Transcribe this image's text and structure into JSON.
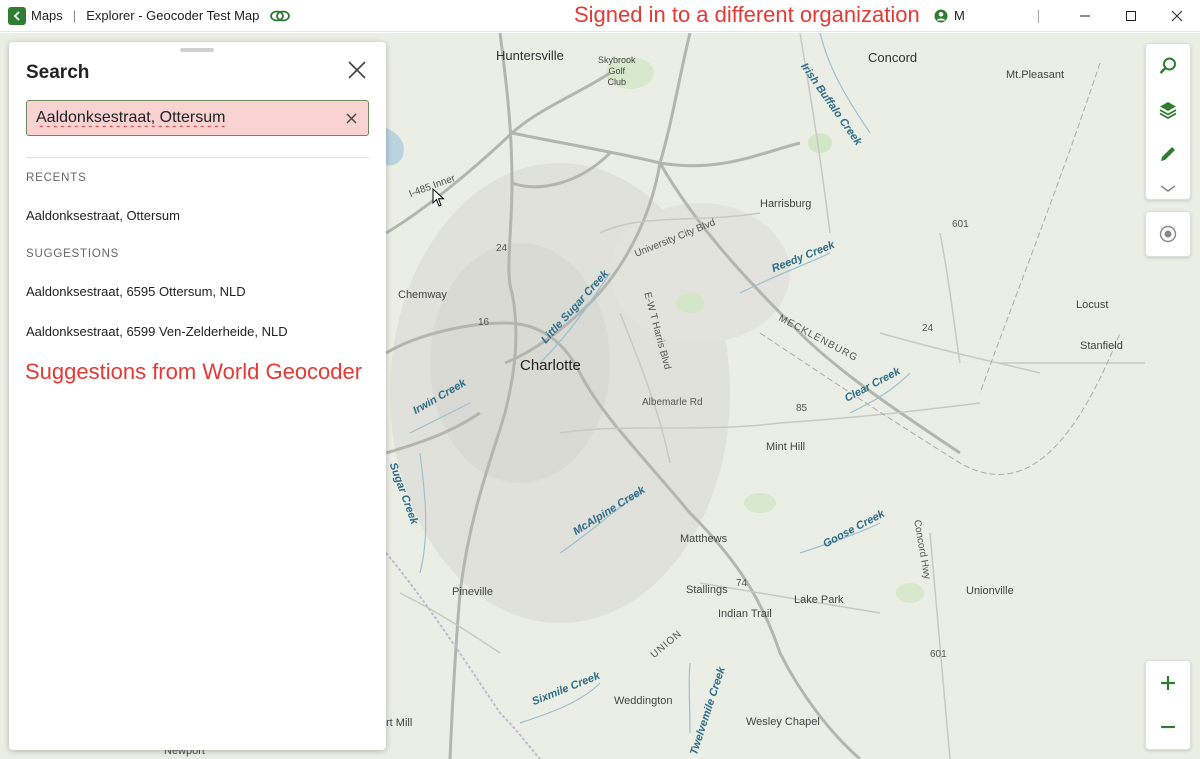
{
  "titlebar": {
    "app_name": "Maps",
    "separator": "|",
    "map_title": "Explorer - Geocoder Test Map",
    "annotation": "Signed in to a different organization",
    "user_initial": "M"
  },
  "search_panel": {
    "title": "Search",
    "query": "Aaldonksestraat, Ottersum",
    "recents_label": "RECENTS",
    "recents": [
      "Aaldonksestraat, Ottersum"
    ],
    "suggestions_label": "SUGGESTIONS",
    "suggestions": [
      "Aaldonksestraat, 6595 Ottersum, NLD",
      "Aaldonksestraat, 6599 Ven-Zelderheide, NLD"
    ],
    "annotation": "Suggestions from World Geocoder"
  },
  "map": {
    "cities": {
      "charlotte": "Charlotte",
      "huntersville": "Huntersville",
      "concord": "Concord",
      "mt_pleasant": "Mt.Pleasant",
      "harrisburg": "Harrisburg",
      "skybrook": "Skybrook\nGolf\nClub",
      "chemway": "Chemway",
      "locust": "Locust",
      "stanfield": "Stanfield",
      "mint_hill": "Mint Hill",
      "matthews": "Matthews",
      "stallings": "Stallings",
      "indian_trail": "Indian Trail",
      "lake_park": "Lake Park",
      "unionville": "Unionville",
      "pineville": "Pineville",
      "weddington": "Weddington",
      "wesley_chapel": "Wesley Chapel",
      "newport": "Newport",
      "mill": "rt Mill"
    },
    "water": {
      "irish_buffalo": "Irish Buffalo Creek",
      "reedy": "Reedy Creek",
      "little_sugar": "Little Sugar Creek",
      "irwin": "Irwin Creek",
      "sugar": "Sugar Creek",
      "mcalpine": "McAlpine Creek",
      "clear": "Clear Creek",
      "goose": "Goose Creek",
      "sixmile": "Sixmile Creek",
      "twelvemile": "Twelvemile Creek"
    },
    "roads": {
      "i485": "I-485 Inner",
      "university": "University City Blvd",
      "albemarle": "Albemarle Rd",
      "wt_harris": "E-W T Harris Blvd",
      "concord_hwy": "Concord Hwy",
      "mecklenburg": "MECKLENBURG",
      "union": "UNION",
      "r24": "24",
      "r24b": "24",
      "r16": "16",
      "r74": "74",
      "r601": "601",
      "r601b": "601",
      "r85": "85"
    }
  },
  "colors": {
    "accent": "#2f7d32",
    "annotation": "#e53935",
    "search_highlight": "#f9d2d2"
  }
}
